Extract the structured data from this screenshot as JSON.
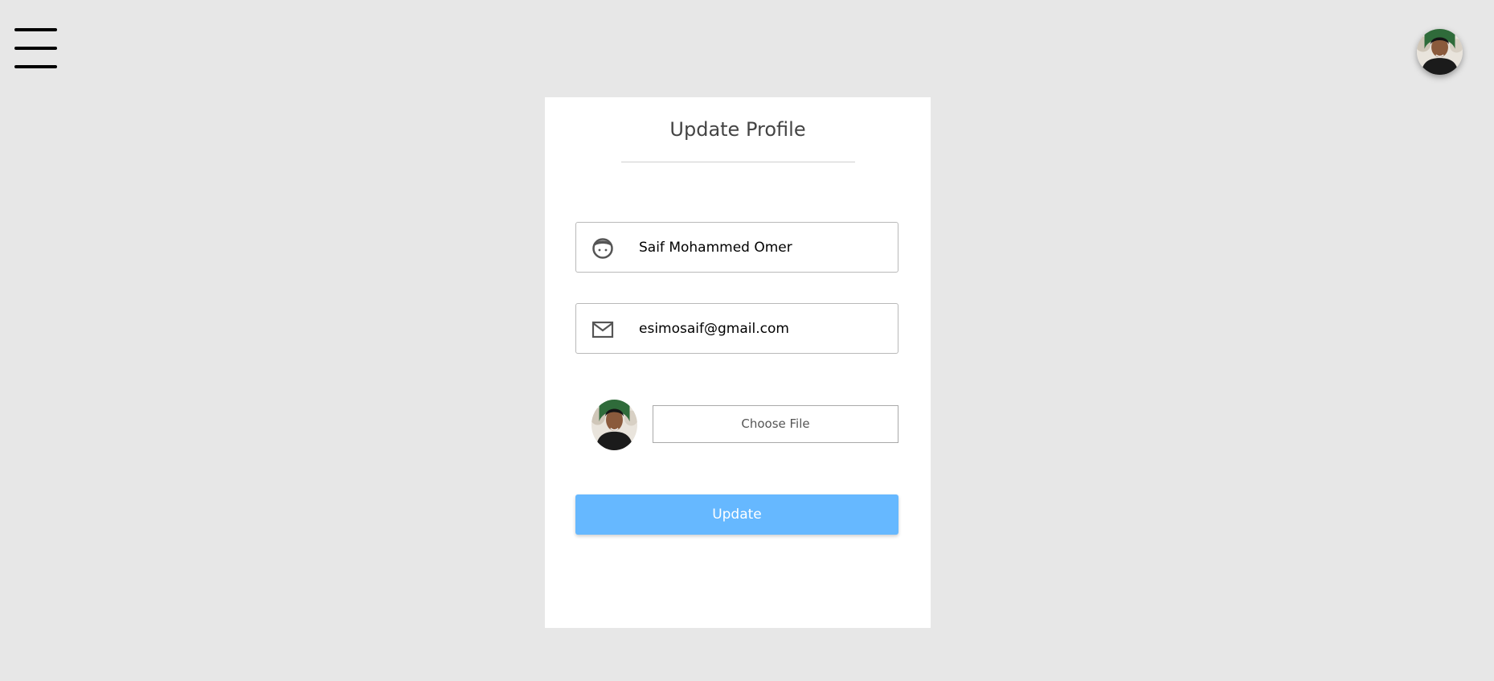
{
  "header": {
    "menu_icon": "hamburger-menu-icon",
    "avatar_icon": "user-avatar"
  },
  "form": {
    "title": "Update Profile",
    "name": {
      "icon": "face-icon",
      "value": "Saif Mohammed Omer"
    },
    "email": {
      "icon": "mail-icon",
      "value": "esimosaif@gmail.com"
    },
    "photo": {
      "avatar_icon": "user-avatar",
      "choose_file_label": "Choose File"
    },
    "submit_label": "Update"
  },
  "colors": {
    "background": "#e7e7e7",
    "card": "#ffffff",
    "button": "#66b8ff",
    "button_text": "#ffffff"
  }
}
